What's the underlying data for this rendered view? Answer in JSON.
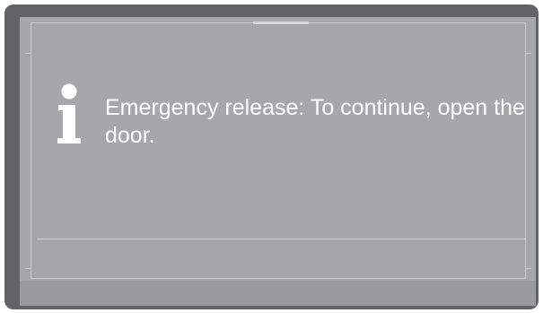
{
  "dialog": {
    "icon": "info-icon",
    "message": "Emergency release: To continue, open the door."
  },
  "colors": {
    "frame": "#626366",
    "screen": "#a6a7aa",
    "text": "#ffffff",
    "lines": "#c8c9cc"
  }
}
